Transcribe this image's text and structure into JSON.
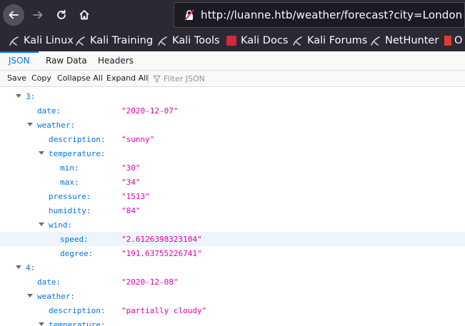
{
  "browser": {
    "url": "http://luanne.htb/weather/forecast?city=London",
    "bookmarks": [
      {
        "label": "Kali Linux",
        "icon": "kali-dragon-icon"
      },
      {
        "label": "Kali Training",
        "icon": "kali-dragon-icon"
      },
      {
        "label": "Kali Tools",
        "icon": "kali-dragon-icon"
      },
      {
        "label": "Kali Docs",
        "icon": "kali-docs-icon"
      },
      {
        "label": "Kali Forums",
        "icon": "kali-dragon-icon"
      },
      {
        "label": "NetHunter",
        "icon": "kali-dragon-icon"
      },
      {
        "label": "O",
        "icon": "offsec-icon"
      }
    ]
  },
  "viewer": {
    "tabs": [
      "JSON",
      "Raw Data",
      "Headers"
    ],
    "toolbar": [
      "Save",
      "Copy",
      "Collapse All",
      "Expand All"
    ],
    "filter_placeholder": "Filter JSON"
  },
  "tree": [
    {
      "key": "3:",
      "value": ""
    },
    {
      "key": "date:",
      "value": "\"2020-12-07\""
    },
    {
      "key": "weather:",
      "value": ""
    },
    {
      "key": "description:",
      "value": "\"sunny\""
    },
    {
      "key": "temperature:",
      "value": ""
    },
    {
      "key": "min:",
      "value": "\"30\""
    },
    {
      "key": "max:",
      "value": "\"34\""
    },
    {
      "key": "pressure:",
      "value": "\"1513\""
    },
    {
      "key": "humidity:",
      "value": "\"84\""
    },
    {
      "key": "wind:",
      "value": ""
    },
    {
      "key": "speed:",
      "value": "\"2.6126398323104\""
    },
    {
      "key": "degree:",
      "value": "\"191.63755226741\""
    },
    {
      "key": "4:",
      "value": ""
    },
    {
      "key": "date:",
      "value": "\"2020-12-08\""
    },
    {
      "key": "weather:",
      "value": ""
    },
    {
      "key": "description:",
      "value": "\"partially cloudy\""
    },
    {
      "key": "temperature:",
      "value": ""
    }
  ],
  "colors": {
    "key": "#0074e8",
    "string_value": "#dd00a9",
    "active_tab": "#0074e8",
    "browser_chrome": "#2b2a33"
  }
}
